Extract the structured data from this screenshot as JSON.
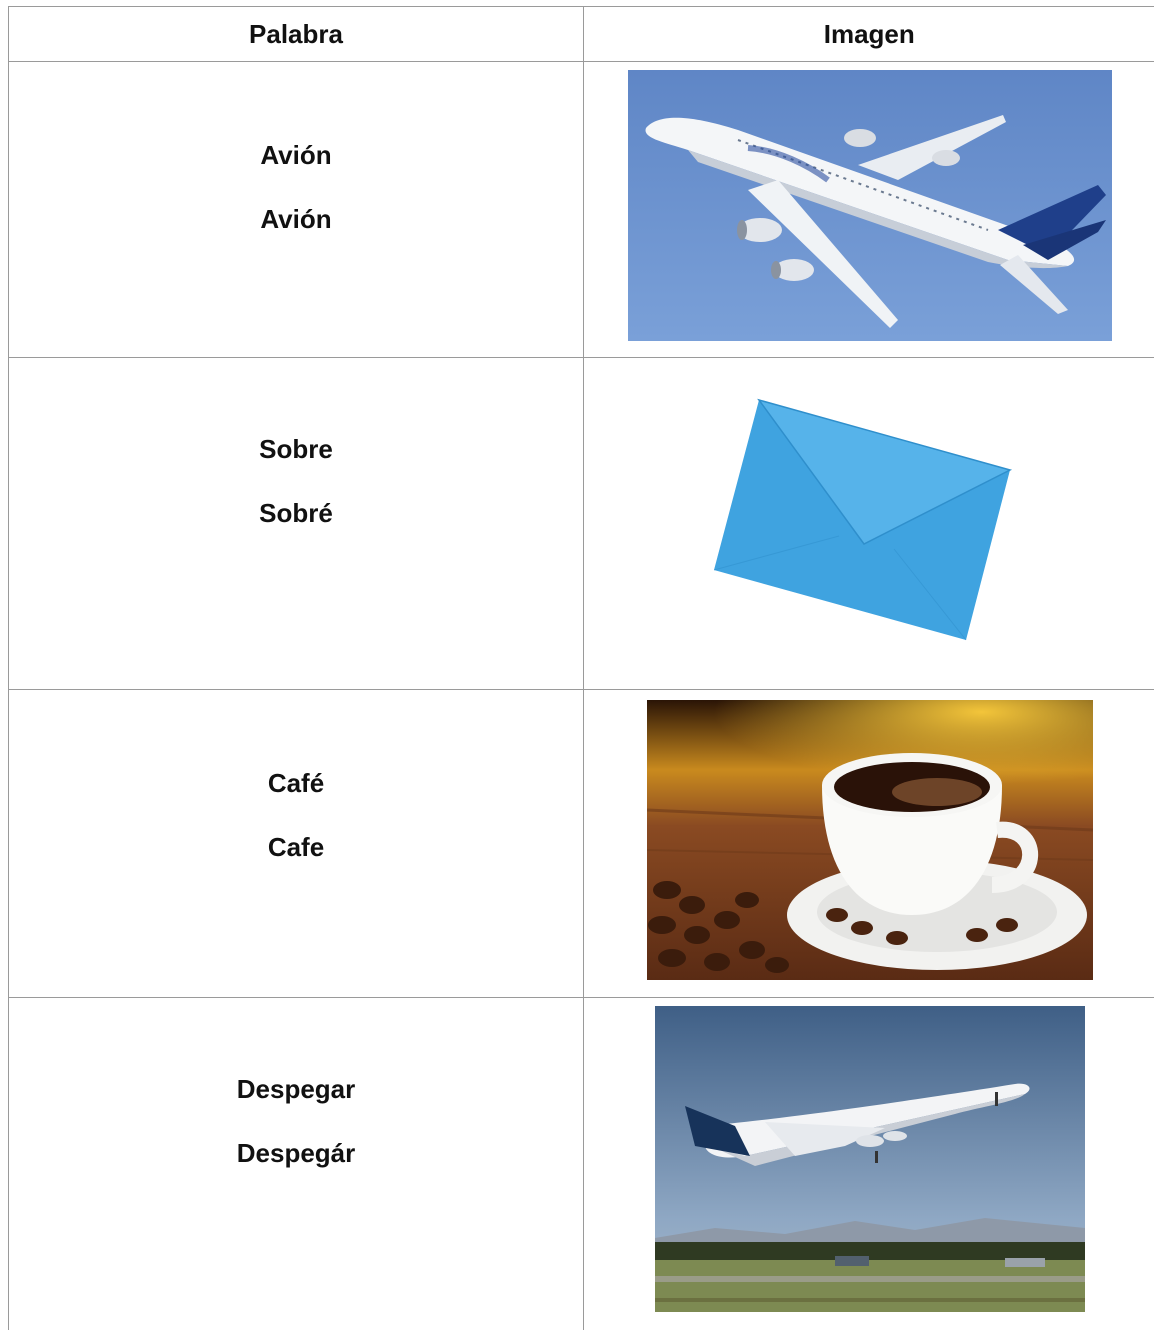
{
  "table": {
    "headers": {
      "word": "Palabra",
      "image": "Imagen"
    },
    "rows": [
      {
        "word_a": "Avión",
        "word_b": "Avión",
        "image_icon": "airplane-in-sky-image"
      },
      {
        "word_a": "Sobre",
        "word_b": "Sobré",
        "image_icon": "blue-envelope-image"
      },
      {
        "word_a": "Café",
        "word_b": "Cafe",
        "image_icon": "coffee-cup-image"
      },
      {
        "word_a": "Despegar",
        "word_b": "Despegár",
        "image_icon": "airplane-takeoff-image"
      }
    ]
  }
}
